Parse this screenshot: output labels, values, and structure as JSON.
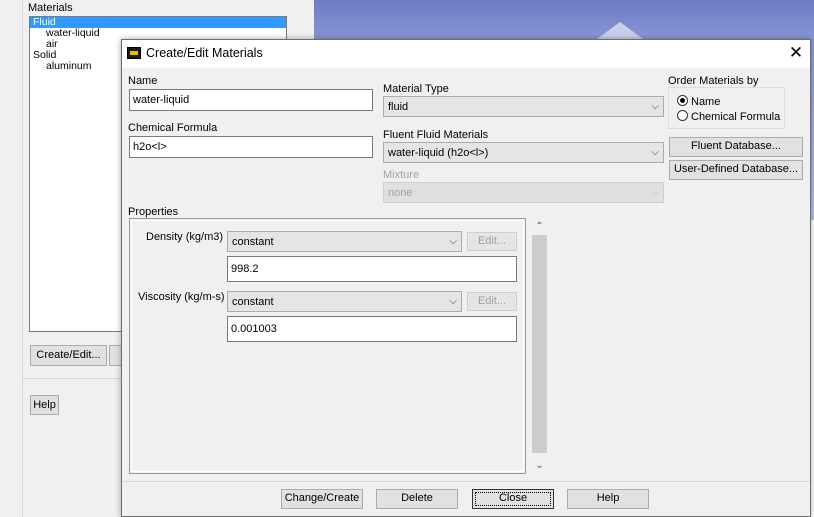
{
  "background": {
    "materials_label": "Materials",
    "list_items": [
      {
        "label": "Fluid",
        "selected": true,
        "indent": 0
      },
      {
        "label": "water-liquid",
        "selected": false,
        "indent": 1
      },
      {
        "label": "air",
        "selected": false,
        "indent": 1
      },
      {
        "label": "Solid",
        "selected": false,
        "indent": 0
      },
      {
        "label": "aluminum",
        "selected": false,
        "indent": 1
      }
    ],
    "create_edit_label": "Create/Edit...",
    "help_label": "Help"
  },
  "dialog": {
    "title": "Create/Edit Materials",
    "close_symbol": "✕",
    "name_label": "Name",
    "name_value": "water-liquid",
    "chemical_formula_label": "Chemical Formula",
    "chemical_formula_value": "h2o<l>",
    "material_type_label": "Material Type",
    "material_type_value": "fluid",
    "fluent_fluid_materials_label": "Fluent Fluid Materials",
    "fluent_fluid_materials_value": "water-liquid (h2o<l>)",
    "mixture_label": "Mixture",
    "mixture_value": "none",
    "order_by_label": "Order Materials by",
    "order_by_options": [
      "Name",
      "Chemical Formula"
    ],
    "order_by_selected": "Name",
    "fluent_database_label": "Fluent Database...",
    "user_defined_database_label": "User-Defined Database...",
    "properties_label": "Properties",
    "properties": [
      {
        "label": "Density (kg/m3)",
        "method": "constant",
        "edit_label": "Edit...",
        "value": "998.2"
      },
      {
        "label": "Viscosity (kg/m-s)",
        "method": "constant",
        "edit_label": "Edit...",
        "value": "0.001003"
      }
    ],
    "buttons": {
      "change_create": "Change/Create",
      "delete": "Delete",
      "close": "Close",
      "help": "Help"
    },
    "chevron": "⌵"
  }
}
